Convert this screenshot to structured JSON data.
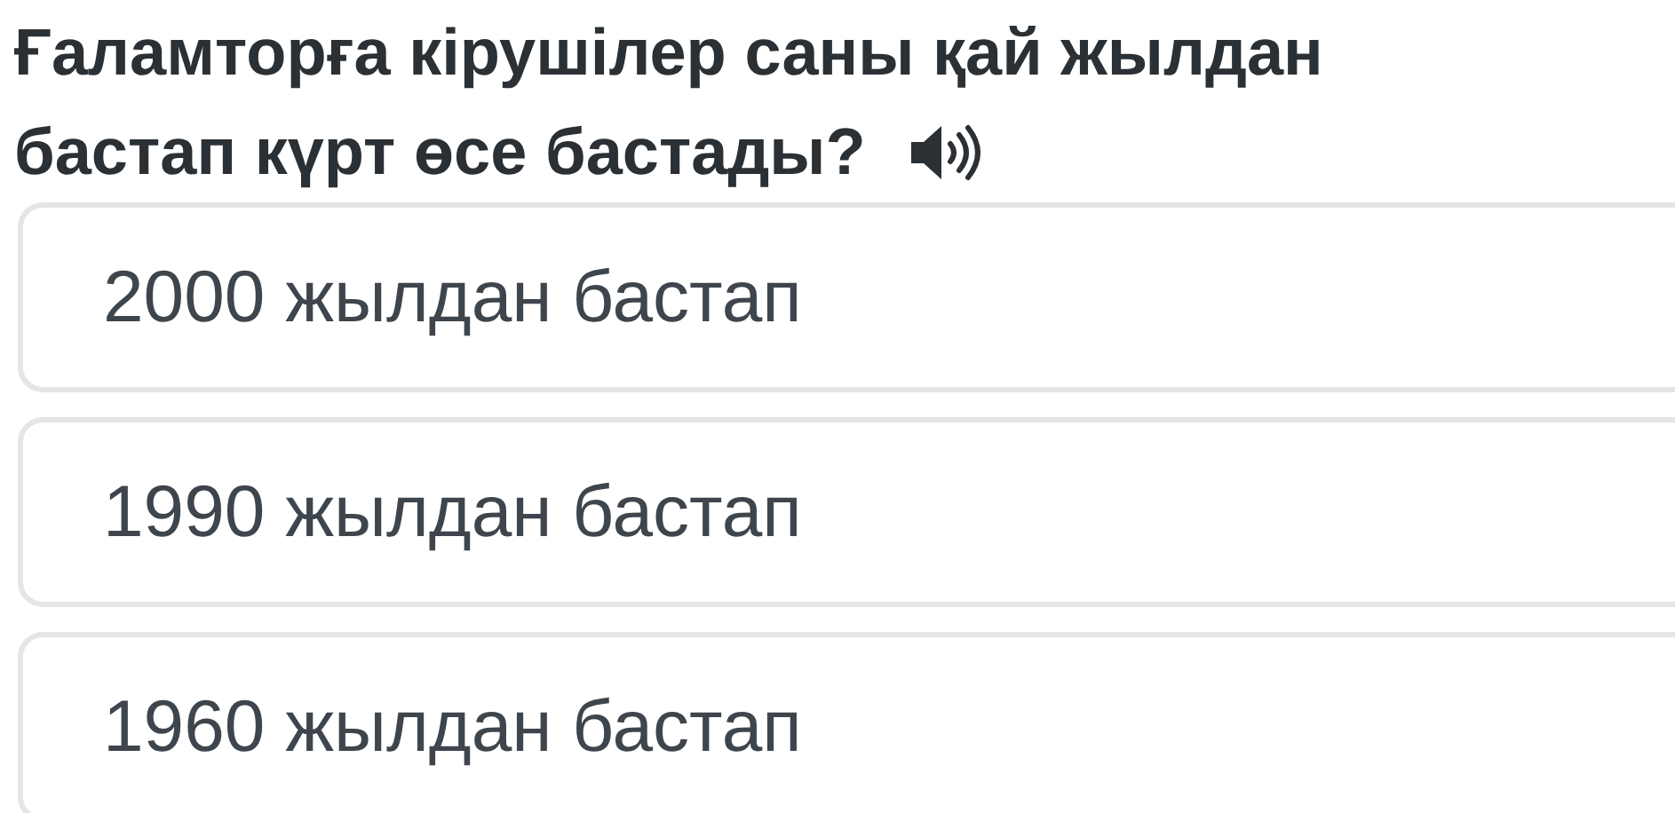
{
  "question": {
    "lines": [
      "Ғаламторға кірушілер саны қай жылдан",
      "бастап күрт өсе бастады?"
    ]
  },
  "options": [
    {
      "label": "2000 жылдан бастап"
    },
    {
      "label": "1990 жылдан бастап"
    },
    {
      "label": "1960 жылдан бастап"
    }
  ]
}
